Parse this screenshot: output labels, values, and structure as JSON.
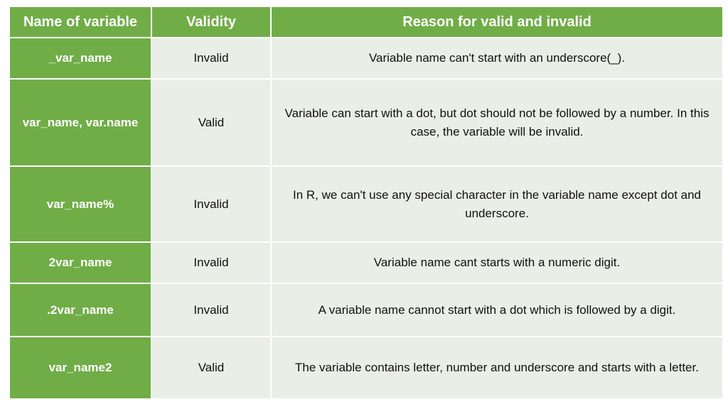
{
  "table": {
    "headers": [
      "Name of variable",
      "Validity",
      "Reason for valid and invalid"
    ],
    "rows": [
      {
        "name": "_var_name",
        "validity": "Invalid",
        "reason": "Variable name can't start with an underscore(_)."
      },
      {
        "name": "var_name, var.name",
        "validity": "Valid",
        "reason": "Variable can start with a dot, but dot should not be followed by a number. In this case, the variable will be invalid."
      },
      {
        "name": "var_name%",
        "validity": "Invalid",
        "reason": "In R, we can't use any special character in the variable name except dot and underscore."
      },
      {
        "name": "2var_name",
        "validity": "Invalid",
        "reason": "Variable name cant starts with a numeric digit."
      },
      {
        "name": ".2var_name",
        "validity": "Invalid",
        "reason": "A variable name cannot start with a dot which is followed by a digit."
      },
      {
        "name": "var_name2",
        "validity": "Valid",
        "reason": "The variable contains letter, number and underscore and starts with a letter."
      }
    ]
  },
  "colors": {
    "header_green": "#70ad47",
    "cell_bg": "#e9eee6"
  }
}
